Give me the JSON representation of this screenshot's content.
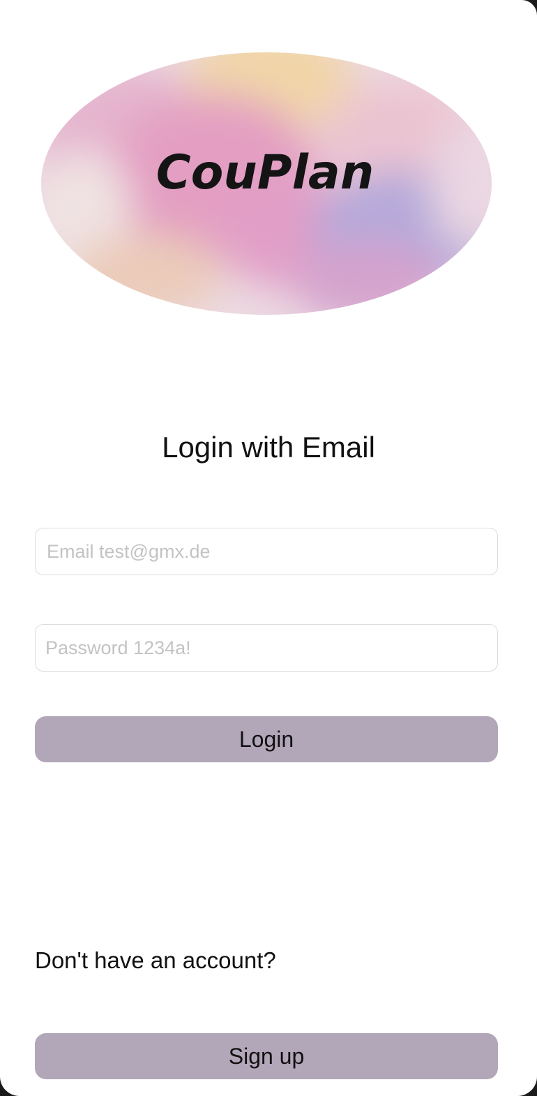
{
  "logo": {
    "text": "CouPlan",
    "palette": [
      "#e7a1c4",
      "#f4d6a4",
      "#a9a3d9",
      "#f1e3e6"
    ]
  },
  "heading": "Login with Email",
  "email_field": {
    "value": "",
    "placeholder": "Email test@gmx.de"
  },
  "password_field": {
    "value": "",
    "placeholder": "Password 1234a!"
  },
  "login_button": "Login",
  "signup_prompt": "Don't have an account?",
  "signup_button": "Sign up",
  "colors": {
    "button_bg": "#b2a6b9",
    "background": "#ffffff",
    "placeholder": "#c3c3c6"
  }
}
